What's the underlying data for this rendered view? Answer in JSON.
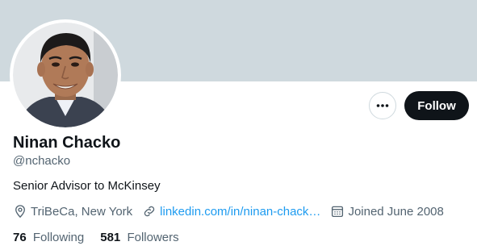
{
  "colors": {
    "banner": "#cfd9de",
    "follow_bg": "#0f1419",
    "link": "#1d9bf0",
    "secondary_text": "#536471"
  },
  "profile": {
    "name": "Ninan Chacko",
    "handle": "@nchacko",
    "bio": "Senior Advisor to McKinsey",
    "location": "TriBeCa, New York",
    "website": "linkedin.com/in/ninan-chack…",
    "joined": "Joined June 2008"
  },
  "actions": {
    "more_icon": "more-dots-icon",
    "follow_label": "Follow"
  },
  "stats": {
    "following_count": "76",
    "following_label": "Following",
    "followers_count": "581",
    "followers_label": "Followers"
  }
}
